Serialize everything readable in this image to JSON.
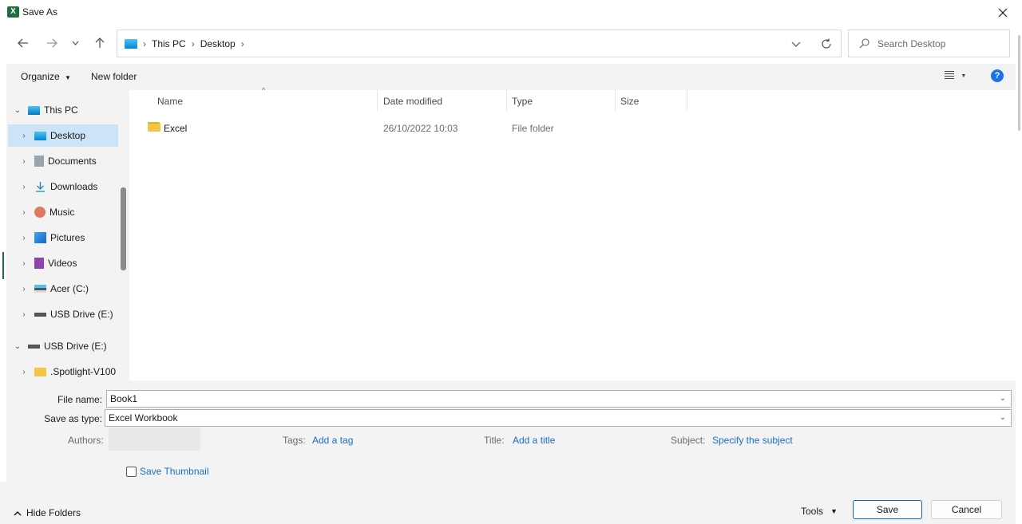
{
  "window": {
    "title": "Save As"
  },
  "nav": {
    "address": [
      "This PC",
      "Desktop"
    ],
    "search_placeholder": "Search Desktop"
  },
  "commands": {
    "organize": "Organize",
    "new_folder": "New folder"
  },
  "tree": {
    "items": [
      {
        "label": "This PC",
        "icon": "computer-icon",
        "level": 0,
        "expanded": true
      },
      {
        "label": "Desktop",
        "icon": "desktop-icon",
        "level": 1,
        "selected": true
      },
      {
        "label": "Documents",
        "icon": "documents-icon",
        "level": 1
      },
      {
        "label": "Downloads",
        "icon": "downloads-icon",
        "level": 1
      },
      {
        "label": "Music",
        "icon": "music-icon",
        "level": 1
      },
      {
        "label": "Pictures",
        "icon": "pictures-icon",
        "level": 1
      },
      {
        "label": "Videos",
        "icon": "videos-icon",
        "level": 1
      },
      {
        "label": "Acer (C:)",
        "icon": "drive-icon",
        "level": 1
      },
      {
        "label": "USB Drive (E:)",
        "icon": "usb-drive-icon",
        "level": 1
      },
      {
        "label": "USB Drive (E:)",
        "icon": "usb-drive-icon",
        "level": 0,
        "expanded": true
      },
      {
        "label": ".Spotlight-V100",
        "icon": "folder-icon",
        "level": 1
      }
    ]
  },
  "filelist": {
    "columns": {
      "name": "Name",
      "date": "Date modified",
      "type": "Type",
      "size": "Size"
    },
    "rows": [
      {
        "name": "Excel",
        "date": "26/10/2022 10:03",
        "type": "File folder",
        "size": ""
      }
    ]
  },
  "form": {
    "file_name_label": "File name:",
    "file_name_value": "Book1",
    "save_type_label": "Save as type:",
    "save_type_value": "Excel Workbook",
    "authors_label": "Authors:",
    "tags_label": "Tags:",
    "tags_link": "Add a tag",
    "title_label": "Title:",
    "title_link": "Add a title",
    "subject_label": "Subject:",
    "subject_link": "Specify the subject",
    "thumbnail_label": "Save Thumbnail"
  },
  "footer": {
    "hide_folders": "Hide Folders",
    "tools": "Tools",
    "save": "Save",
    "cancel": "Cancel"
  },
  "colors": {
    "selection": "#cce4f7",
    "link": "#1a6ec2",
    "accent": "#0067c0"
  }
}
